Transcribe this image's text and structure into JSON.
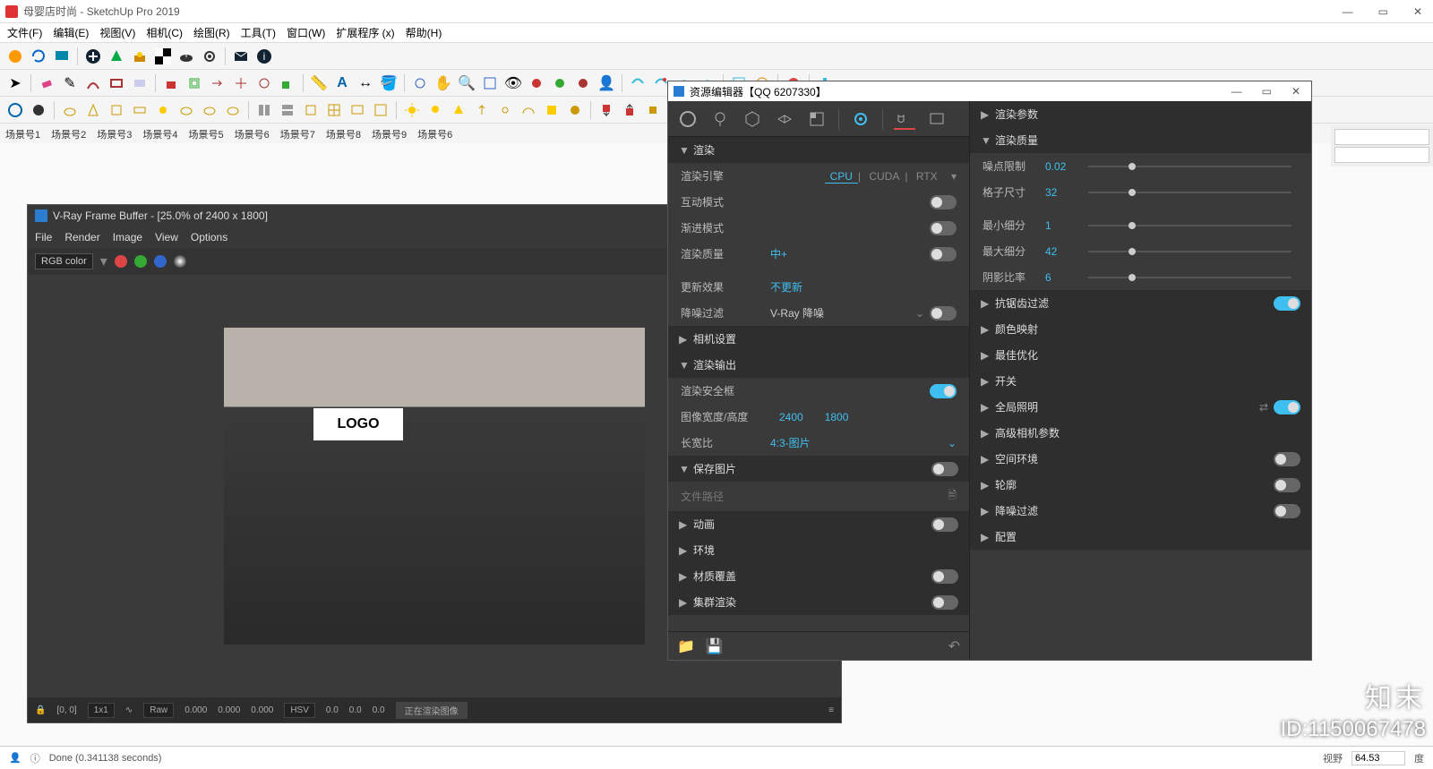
{
  "window": {
    "title": "母婴店时尚 - SketchUp Pro 2019"
  },
  "menu": [
    "文件(F)",
    "编辑(E)",
    "视图(V)",
    "相机(C)",
    "绘图(R)",
    "工具(T)",
    "窗口(W)",
    "扩展程序 (x)",
    "帮助(H)"
  ],
  "scenes": [
    "场景号1",
    "场景号2",
    "场景号3",
    "场景号4",
    "场景号5",
    "场景号6",
    "场景号7",
    "场景号8",
    "场景号9",
    "场景号6"
  ],
  "toolbar_icons_row1": [
    "ext-orange",
    "refresh",
    "screen",
    "plus-circle",
    "tree",
    "sun",
    "checker",
    "cloud-up",
    "gear",
    "mail",
    "info"
  ],
  "toolbar_icons_row2": [
    "pointer",
    "eraser",
    "pencil",
    "arc",
    "rect3",
    "sheet",
    "cube-red",
    "cube-green",
    "push",
    "offset",
    "follow",
    "move",
    "rotate",
    "scale",
    "tape",
    "text",
    "dim",
    "paint",
    "zoom",
    "pan",
    "orbit",
    "zoom-ext",
    "eye",
    "mat-red",
    "mat-green",
    "mat-blue",
    "user",
    "vray-render",
    "vray-rt",
    "vray-cloud",
    "vray-cloud2",
    "vray-rect",
    "vray-stop",
    "vray-chrome",
    "potion"
  ],
  "toolbar_icons_row3": [
    "world",
    "circle",
    "teapot",
    "cone",
    "box",
    "plane",
    "sun2",
    "cloud2",
    "cloud3",
    "cloud4",
    "light-cone",
    "light-sphere",
    "light-dome",
    "light-sun",
    "light-rect",
    "light-omni",
    "light-ies",
    "cone3",
    "cone4",
    "checker2",
    "add1",
    "add2",
    "add3",
    "add4",
    "arrow-dn",
    "arrow-up",
    "gear2",
    "info2"
  ],
  "vfb": {
    "title": "V-Ray Frame Buffer - [25.0% of 2400 x 1800]",
    "menu": [
      "File",
      "Render",
      "Image",
      "View",
      "Options"
    ],
    "channel": "RGB color",
    "render_logo": "LOGO",
    "status_coords": "[0, 0]",
    "status_scale": "1x1",
    "status_raw": "Raw",
    "status_rgb": [
      "0.000",
      "0.000",
      "0.000"
    ],
    "status_hsv_label": "HSV",
    "status_hsv": [
      "0.0",
      "0.0",
      "0.0"
    ],
    "status_progress": "正在渲染图像"
  },
  "asset": {
    "title": "资源编辑器【QQ 6207330】",
    "left": {
      "section_render": "渲染",
      "engine_label": "渲染引擎",
      "engines": [
        "CPU",
        "CUDA",
        "RTX"
      ],
      "engine_active": "CPU",
      "interactive_label": "互动模式",
      "progressive_label": "渐进模式",
      "quality_label": "渲染质量",
      "quality_value": "中+",
      "update_label": "更新效果",
      "update_value": "不更新",
      "denoise_label": "降噪过滤",
      "denoise_value": "V-Ray 降噪",
      "section_camera": "相机设置",
      "section_output": "渲染输出",
      "safe_frame_label": "渲染安全框",
      "image_size_label": "图像宽度/高度",
      "image_width": "2400",
      "image_height": "1800",
      "aspect_label": "长宽比",
      "aspect_value": "4:3-图片",
      "section_save": "保存图片",
      "file_path_label": "文件路径",
      "section_anim": "动画",
      "section_env": "环境",
      "section_matoverride": "材质覆盖",
      "section_swarm": "集群渲染"
    },
    "right": {
      "section_params": "渲染参数",
      "section_quality": "渲染质量",
      "noise_limit_label": "噪点限制",
      "noise_limit_value": "0.02",
      "bucket_label": "格子尺寸",
      "bucket_value": "32",
      "min_subd_label": "最小细分",
      "min_subd_value": "1",
      "max_subd_label": "最大细分",
      "max_subd_value": "42",
      "shading_label": "阴影比率",
      "shading_value": "6",
      "section_aa": "抗锯齿过滤",
      "section_colormap": "颜色映射",
      "section_optim": "最佳优化",
      "section_switch": "开关",
      "section_gi": "全局照明",
      "section_advcam": "高级相机参数",
      "section_envspace": "空间环境",
      "section_contour": "轮廓",
      "section_denoise": "降噪过滤",
      "section_config": "配置"
    }
  },
  "status": {
    "done": "Done (0.341138 seconds)",
    "view_label": "视野",
    "view_value": "64.53",
    "view_unit": "度"
  },
  "watermark": {
    "zh": "知末",
    "id": "ID:1150067478"
  }
}
